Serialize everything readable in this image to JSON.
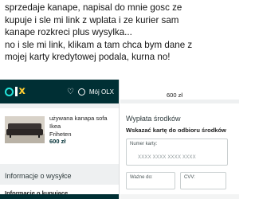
{
  "caption": {
    "lines": [
      "sprzedaje kanape, napisal do mnie gosc ze",
      "kupuje i sle mi link z wplata i ze kurier sam",
      "kanape rozkreci plus wysylka...",
      "no i sle mi link, klikam a tam chca bym dane z",
      "mojej karty kredytowej podala, kurna no!"
    ]
  },
  "left_screen": {
    "header": {
      "logo": "OLX",
      "account_label": "Mój OLX",
      "icons": [
        "heart-icon",
        "user-icon"
      ]
    },
    "listing": {
      "title_line1": "używana kanapa sofa Ikea",
      "title_line2": "Friheten",
      "price": "600 zł"
    },
    "section_title": "Informacje o wysyłce",
    "buyer_info_label": "Informacje o kupujące"
  },
  "right_screen": {
    "price": "600 zł",
    "payment_title": "Wypłata środków",
    "instruction": "Wskazać kartę do odbioru środków",
    "card_number_label": "Numer karty:",
    "card_number_placeholder": "XXXX XXXX XXXX XXXX",
    "valid_label": "Ważne do:",
    "cvv_label": "CVV:"
  },
  "colors": {
    "olx_dark": "#002f34",
    "olx_teal": "#23e5db",
    "olx_yellow": "#ffce32"
  }
}
